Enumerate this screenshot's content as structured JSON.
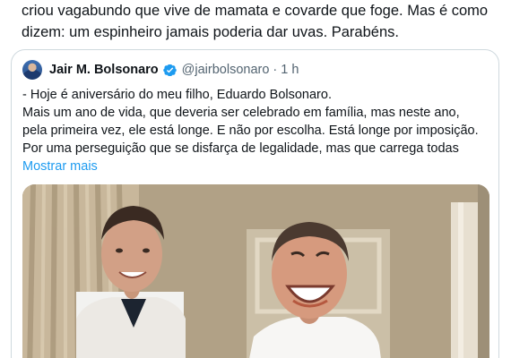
{
  "post": {
    "lines": [
      "criou vagabundo que vive de mamata e covarde que foge. Mas é como",
      "dizem: um espinheiro jamais poderia dar uvas. Parabéns."
    ]
  },
  "quoted": {
    "author_name": "Jair M. Bolsonaro",
    "handle": "@jairbolsonaro",
    "separator": "·",
    "time": "1 h",
    "lines": [
      "- Hoje é aniversário do meu filho, Eduardo Bolsonaro.",
      "Mais um ano de vida, que deveria ser celebrado em família, mas neste ano,",
      "pela primeira vez, ele está longe. E não por escolha. Está longe por imposição.",
      "Por uma perseguição que se disfarça de legalidade, mas que carrega todas"
    ],
    "show_more": "Mostrar mais",
    "verified_color": "#1d9bf0"
  },
  "colors": {
    "text": "#0f1419",
    "secondary": "#536471",
    "link": "#1d9bf0",
    "border": "#cfd9de"
  }
}
